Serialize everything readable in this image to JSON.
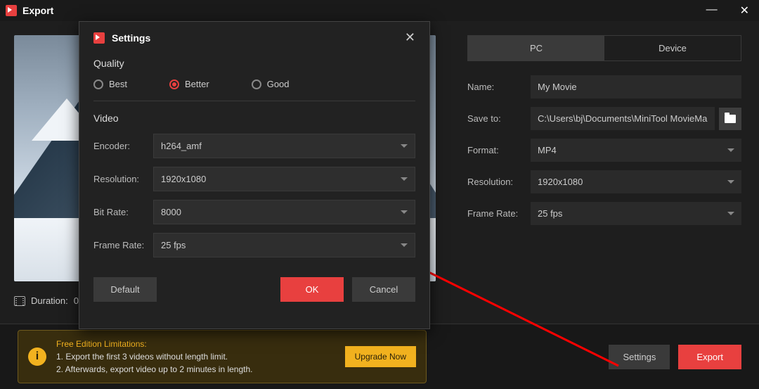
{
  "titlebar": {
    "title": "Export"
  },
  "tabs": {
    "pc": "PC",
    "device": "Device"
  },
  "labels": {
    "name": "Name:",
    "saveto": "Save to:",
    "format": "Format:",
    "resolution": "Resolution:",
    "framerate": "Frame Rate:",
    "duration": "Duration:"
  },
  "main": {
    "name": "My Movie",
    "saveto": "C:\\Users\\bj\\Documents\\MiniTool MovieMaker\\outp",
    "format": "MP4",
    "resolution": "1920x1080",
    "framerate": "25 fps",
    "duration": "0"
  },
  "footer": {
    "limit_title": "Free Edition Limitations:",
    "limit_1": "1. Export the first 3 videos without length limit.",
    "limit_2": "2. Afterwards, export video up to 2 minutes in length.",
    "upgrade": "Upgrade Now",
    "settings": "Settings",
    "export": "Export"
  },
  "modal": {
    "title": "Settings",
    "quality_sect": "Quality",
    "best": "Best",
    "better": "Better",
    "good": "Good",
    "video_sect": "Video",
    "encoder_label": "Encoder:",
    "encoder": "h264_amf",
    "resolution_label": "Resolution:",
    "resolution": "1920x1080",
    "bitrate_label": "Bit Rate:",
    "bitrate": "8000",
    "framerate_label": "Frame Rate:",
    "framerate": "25 fps",
    "default": "Default",
    "ok": "OK",
    "cancel": "Cancel"
  }
}
